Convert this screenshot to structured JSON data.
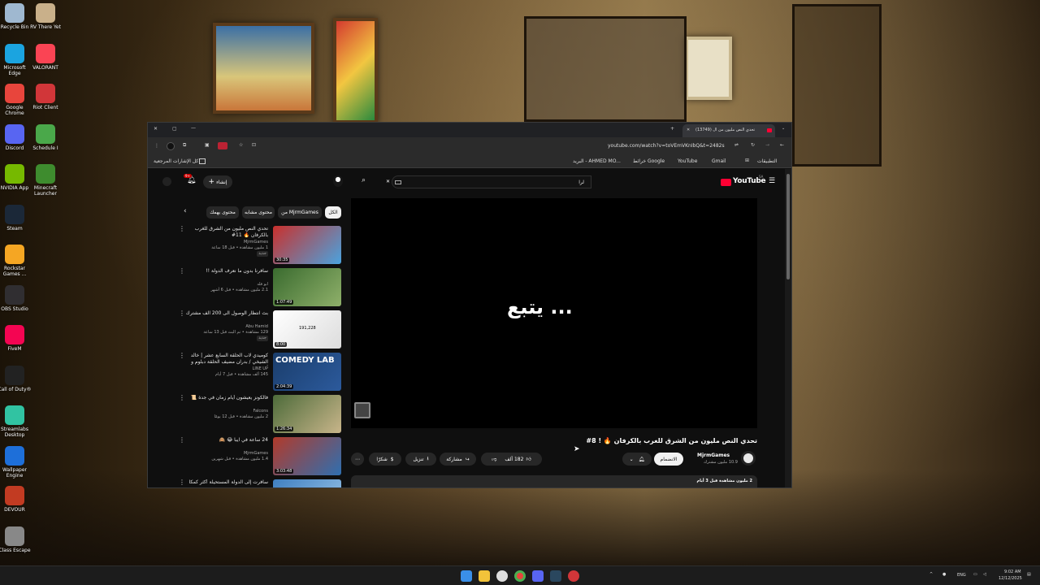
{
  "desktop": {
    "icons": [
      {
        "label": "Recycle Bin",
        "color": "#9fb8d0"
      },
      {
        "label": "RV There Yet",
        "color": "#c9b08a"
      },
      {
        "label": "Microsoft Edge",
        "color": "#1ba4e0"
      },
      {
        "label": "VALORANT",
        "color": "#fa4454"
      },
      {
        "label": "Google Chrome",
        "color": "#e8453c"
      },
      {
        "label": "Riot Client",
        "color": "#d13639"
      },
      {
        "label": "Discord",
        "color": "#5865f2"
      },
      {
        "label": "Schedule I",
        "color": "#4aa84a"
      },
      {
        "label": "NVIDIA App",
        "color": "#76b900"
      },
      {
        "label": "Minecraft Launcher",
        "color": "#3e8c2e"
      },
      {
        "label": "Steam",
        "color": "#1b2838"
      },
      {
        "label": "Rockstar Games ...",
        "color": "#f5a623"
      },
      {
        "label": "OBS Studio",
        "color": "#302e31"
      },
      {
        "label": "FiveM",
        "color": "#f40552"
      },
      {
        "label": "Call of Duty®",
        "color": "#222222"
      },
      {
        "label": "Streamlabs Desktop",
        "color": "#31c3a2"
      },
      {
        "label": "Wallpaper Engine",
        "color": "#1e6fd9"
      },
      {
        "label": "DEVOUR",
        "color": "#c23b22"
      },
      {
        "label": "Class Escape",
        "color": "#888888"
      }
    ]
  },
  "browser": {
    "tab_title": "(13749) تحدي النص مليون من ال",
    "url": "youtube.com/watch?v=toVEmVKnIbQ&t=2482s",
    "bookmarks": [
      "التطبيقات",
      "Gmail",
      "YouTube",
      "خرائط Google",
      "البريد - AHMED MO..."
    ],
    "bookmarks_all": "كل الإشارات المرجعية"
  },
  "youtube": {
    "logo": "YouTube",
    "region": "SA",
    "search_value": "لرا",
    "create_label": "إنشاء",
    "notif_count": "9+",
    "player_text": "يتبع ...",
    "video_title": "تحدي النص مليون من الشرق للغرب بالكرفان 🔥 ! 8#",
    "channel_name": "MjrmGames",
    "subscribers": "10.9 مليون مشترك",
    "join_label": "الانضمام",
    "likes": "182 ألف",
    "share_label": "مشاركة",
    "download_label": "تنزيل",
    "thanks_label": "شكرًا",
    "views_line": "2 مليون مشاهدة قبل 3 أيام",
    "chips": [
      "الكل",
      "من MjrmGames",
      "محتوى مشابه",
      "محتوى يهمك"
    ],
    "related": [
      {
        "title": "تحدي النص مليون من الشرق للغرب بالكرفان 🔥 11#",
        "channel": "MjrmGames",
        "meta": "1 مليون مشاهدة • قبل 18 ساعة",
        "badge": "جديد",
        "duration": "30:35",
        "c1": "#c9302c",
        "c2": "#4aa3df"
      },
      {
        "title": "سافرنا بدون ما نعرف الدولة !!",
        "channel": "ابو فله",
        "meta": "2.1 مليون مشاهدة • قبل 6 أشهر",
        "badge": "",
        "duration": "1:07:49",
        "c1": "#3a6b2f",
        "c2": "#8fb06a"
      },
      {
        "title": "بث انتظار الوصول الى 200 الف مشترك",
        "channel": "Abu Hamid",
        "meta": "129 مشاهدة • تم البث قبل 13 ساعة",
        "badge": "جديد",
        "duration": "8:00",
        "thumb_num": "191,228",
        "c1": "#ffffff",
        "c2": "#dddddd"
      },
      {
        "title": "كوميدي لاب الحلقة السابع عشر | خالد الشيخي / بدران مضيف الحلقة دبلوم و أؤك...",
        "channel": "LINE UP",
        "meta": "145 ألف مشاهدة • قبل 7 أيام",
        "badge": "",
        "duration": "2:04:39",
        "thumb_text": "COMEDY LAB",
        "c1": "#1a3d6b",
        "c2": "#2c5a9c"
      },
      {
        "title": "فالكونز يعيشون أيام زمان في جدة 📜",
        "channel": "Falcons",
        "meta": "2 مليون مشاهدة • قبل 12 يومًا",
        "badge": "",
        "duration": "1:26:34",
        "c1": "#4d6b3a",
        "c2": "#c8b58a"
      },
      {
        "title": "24 ساعة في ايبا 😂 🙈",
        "channel": "MjrmGames",
        "meta": "1.4 مليون مشاهدة • قبل شهرين",
        "badge": "",
        "duration": "3:03:48",
        "c1": "#b23a2a",
        "c2": "#2f6fb0"
      },
      {
        "title": "سافرت إلى الدولة المستحيلة أكثر كمكا",
        "channel": "",
        "meta": "",
        "badge": "",
        "duration": "",
        "c1": "#3f7fc0",
        "c2": "#9cc6ea"
      }
    ]
  },
  "taskbar": {
    "lang": "ENG",
    "time": "9:02 AM",
    "date": "12/12/2025"
  },
  "colors": {
    "yt_red": "#ff0033",
    "bg": "#0f0f0f",
    "chip": "#272727"
  }
}
